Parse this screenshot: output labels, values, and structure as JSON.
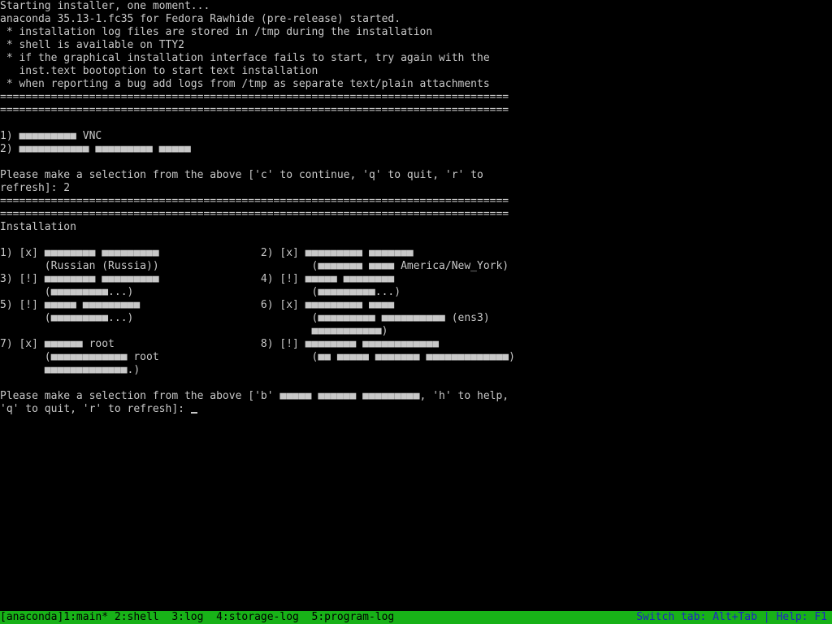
{
  "terminal": {
    "lines": [
      "Starting installer, one moment...",
      "anaconda 35.13-1.fc35 for Fedora Rawhide (pre-release) started.",
      " * installation log files are stored in /tmp during the installation",
      " * shell is available on TTY2",
      " * if the graphical installation interface fails to start, try again with the",
      "   inst.text bootoption to start text installation",
      " * when reporting a bug add logs from /tmp as separate text/plain attachments",
      "================================================================================",
      "================================================================================",
      "",
      "1) ■■■■■■■■■ VNC",
      "2) ■■■■■■■■■■■ ■■■■■■■■■ ■■■■■",
      "",
      "Please make a selection from the above ['c' to continue, 'q' to quit, 'r' to",
      "refresh]: 2",
      "================================================================================",
      "================================================================================",
      "Installation",
      "",
      "1) [x] ■■■■■■■■ ■■■■■■■■■                2) [x] ■■■■■■■■■ ■■■■■■■",
      "       (Russian (Russia))                        (■■■■■■■ ■■■■ America/New_York)",
      "3) [!] ■■■■■■■■ ■■■■■■■■■                4) [!] ■■■■■ ■■■■■■■■",
      "       (■■■■■■■■■...)                            (■■■■■■■■■...)",
      "5) [!] ■■■■■ ■■■■■■■■■                   6) [x] ■■■■■■■■■ ■■■■",
      "       (■■■■■■■■■...)                            (■■■■■■■■■ ■■■■■■■■■■ (ens3)",
      "                                                 ■■■■■■■■■■■)",
      "7) [x] ■■■■■■ root                       8) [!] ■■■■■■■■ ■■■■■■■■■■■■",
      "       (■■■■■■■■■■■■ root                        (■■ ■■■■■ ■■■■■■■ ■■■■■■■■■■■■■)",
      "       ■■■■■■■■■■■■■.)",
      "",
      "Please make a selection from the above ['b' ■■■■■ ■■■■■■ ■■■■■■■■■, 'h' to help,",
      "'q' to quit, 'r' to refresh]: "
    ]
  },
  "status_bar": {
    "left": "[anaconda]1:main* 2:shell  3:log  4:storage-log  5:program-log",
    "right": "Switch tab: Alt+Tab | Help: F1"
  },
  "colors": {
    "background": "#000000",
    "text": "#c8c8c8",
    "status_bar_bg": "#18b218",
    "status_bar_left_text": "#000000",
    "status_bar_right_text": "#2020c8"
  }
}
